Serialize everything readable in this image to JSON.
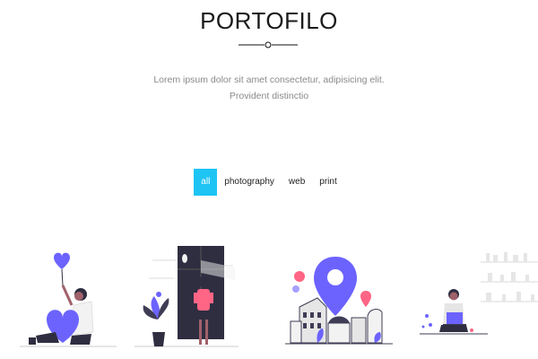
{
  "section": {
    "title": "PORTOFILO",
    "subtitle_line1": "Lorem ipsum dolor sit amet consectetur, adipisicing elit.",
    "subtitle_line2": "Provident distinctio"
  },
  "filters": {
    "items": [
      {
        "label": "all",
        "active": true
      },
      {
        "label": "photography",
        "active": false
      },
      {
        "label": "web",
        "active": false
      },
      {
        "label": "print",
        "active": false
      }
    ]
  },
  "colors": {
    "accent": "#1ec4f3",
    "illustration_primary": "#6c63ff",
    "illustration_pink": "#ff6584",
    "illustration_dark": "#2f2e41"
  },
  "gallery": {
    "items": [
      {
        "icon": "person-with-hearts-illustration"
      },
      {
        "icon": "woman-at-door-illustration"
      },
      {
        "icon": "city-location-pin-illustration"
      },
      {
        "icon": "person-with-laptop-illustration"
      },
      {
        "icon": "shelves-illustration"
      }
    ]
  }
}
